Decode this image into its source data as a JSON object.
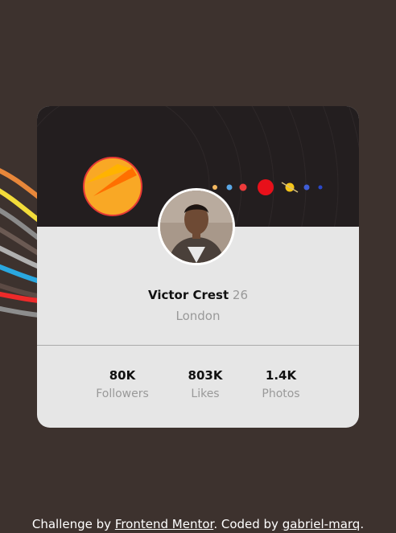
{
  "profile": {
    "name": "Victor Crest",
    "age": "26",
    "location": "London"
  },
  "stats": [
    {
      "value": "80K",
      "label": "Followers"
    },
    {
      "value": "803K",
      "label": "Likes"
    },
    {
      "value": "1.4K",
      "label": "Photos"
    }
  ],
  "footer": {
    "prefix": "Challenge by ",
    "link1": "Frontend Mentor",
    "middle": ". Coded by ",
    "link2": "gabriel-marq",
    "suffix": "."
  },
  "colors": {
    "background": "#3d322e",
    "card": "#e6e6e6",
    "banner": "#231e1f"
  }
}
